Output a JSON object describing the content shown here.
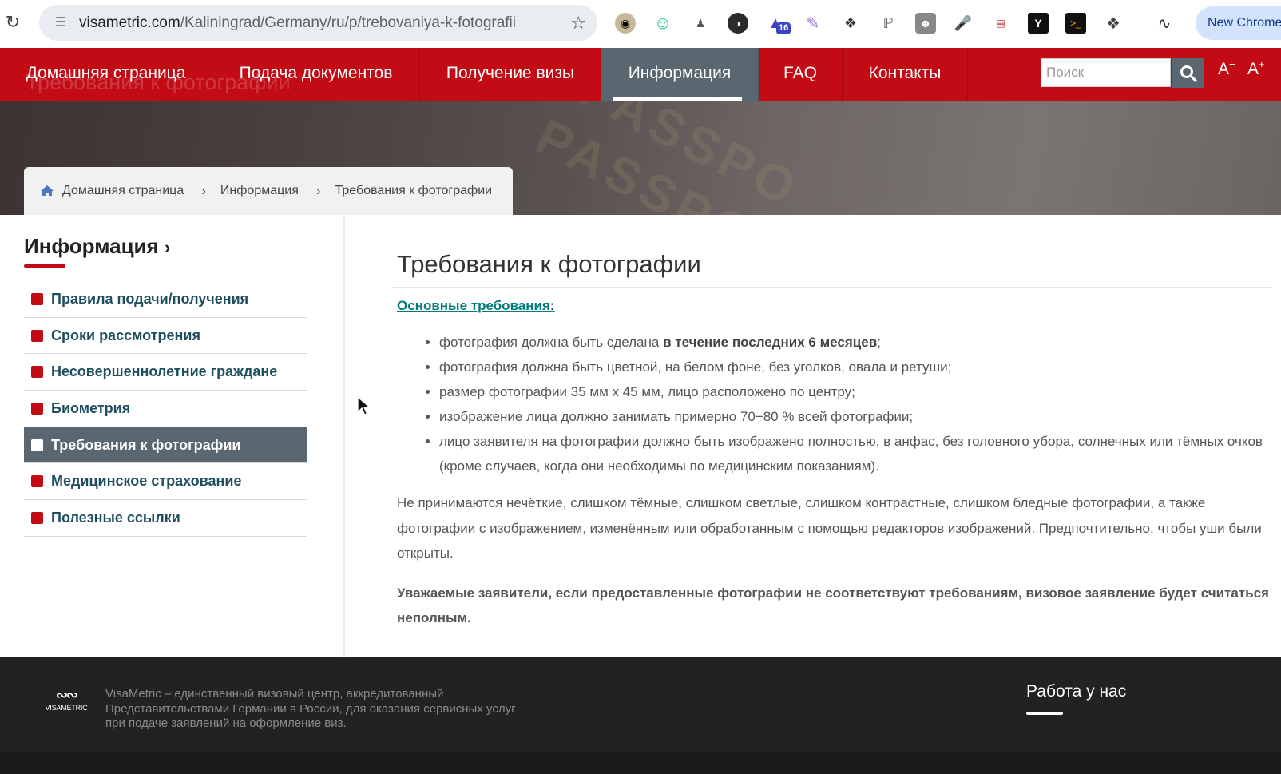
{
  "browser": {
    "url_host": "visametric.com",
    "url_path": "/Kaliningrad/Germany/ru/p/trebovaniya-k-fotografii",
    "extension_badge": "16",
    "new_chrome_label": "New Chrome"
  },
  "nav": {
    "items": [
      {
        "label": "Домашняя страница"
      },
      {
        "label": "Подача документов"
      },
      {
        "label": "Получение визы"
      },
      {
        "label": "Информация"
      },
      {
        "label": "FAQ"
      },
      {
        "label": "Контакты"
      }
    ],
    "search_placeholder": "Поиск",
    "font_smaller": "A",
    "font_smaller_sign": "−",
    "font_larger": "A",
    "font_larger_sign": "+",
    "ghost_title": "Требования к фотографии",
    "accent_color": "#c30b15",
    "active_color": "#5a6670"
  },
  "hero": {
    "bg_words": [
      "PASSPO",
      "PASSPO"
    ]
  },
  "breadcrumb": {
    "items": [
      "Домашняя страница",
      "Информация",
      "Требования к фотографии"
    ]
  },
  "sidebar": {
    "title": "Информация",
    "items": [
      {
        "label": "Правила подачи/получения"
      },
      {
        "label": "Сроки рассмотрения"
      },
      {
        "label": "Несовершеннолетние граждане"
      },
      {
        "label": "Биометрия"
      },
      {
        "label": "Требования к фотографии"
      },
      {
        "label": "Медицинское страхование"
      },
      {
        "label": "Полезные ссылки"
      }
    ]
  },
  "main": {
    "title": "Требования к фотографии",
    "requirements_link": "Основные требования",
    "requirements_colon": ":",
    "bullet_1_pre": "фотография должна быть сделана ",
    "bullet_1_bold": "в течение последних 6 месяцев",
    "bullet_1_post": ";",
    "bullet_2": "фотография должна быть цветной, на белом фоне, без уголков, овала и ретуши;",
    "bullet_3": "размер фотографии 35 мм x 45 мм, лицо расположено по центру;",
    "bullet_4": "изображение лица должно занимать примерно 70−80 % всей фотографии;",
    "bullet_5": "лицо заявителя на фотографии должно быть изображено полностью, в анфас, без головного убора, солнечных или тёмных очков (кроме случаев, когда они необходимы по медицинским показаниям).",
    "paragraph": "Не принимаются нечёткие, слишком тёмные, слишком светлые, слишком контрастные, слишком бледные фотографии, а также фотографии с изображением, изменённым или обработанным с помощью редакторов изображений. Предпочтительно, чтобы уши были открыты.",
    "notice": "Уважаемые заявители, если предоставленные фотографии не соответствуют требованиям, визовое заявление будет считаться неполным."
  },
  "footer": {
    "logo_word": "VISAMETRIC",
    "description": "VisaMetric – единственный визовый центр, аккредитованный Представительствами Германии в России, для оказания сервисных услуг при подаче заявлений на оформление виз.",
    "work_title": "Работа у нас"
  }
}
